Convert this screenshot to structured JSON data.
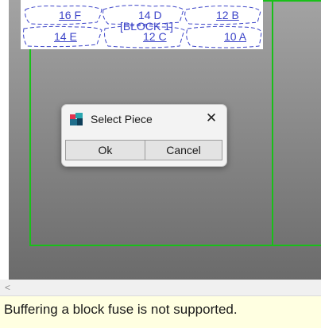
{
  "block": {
    "label": "[BLOCK 1]",
    "pieces": [
      "16 F",
      "14 D",
      "12 B",
      "14 E",
      "12 C",
      "10 A"
    ]
  },
  "dialog": {
    "title": "Select Piece",
    "ok_label": "Ok",
    "cancel_label": "Cancel",
    "close_glyph": "✕",
    "icon": "app-icon"
  },
  "scrollbar": {
    "left_arrow": "<"
  },
  "status": {
    "message": "Buffering a block fuse is not supported."
  },
  "colors": {
    "block_outline": "#19c019",
    "piece_text": "#3c44c8",
    "status_background": "#ffffe1"
  }
}
